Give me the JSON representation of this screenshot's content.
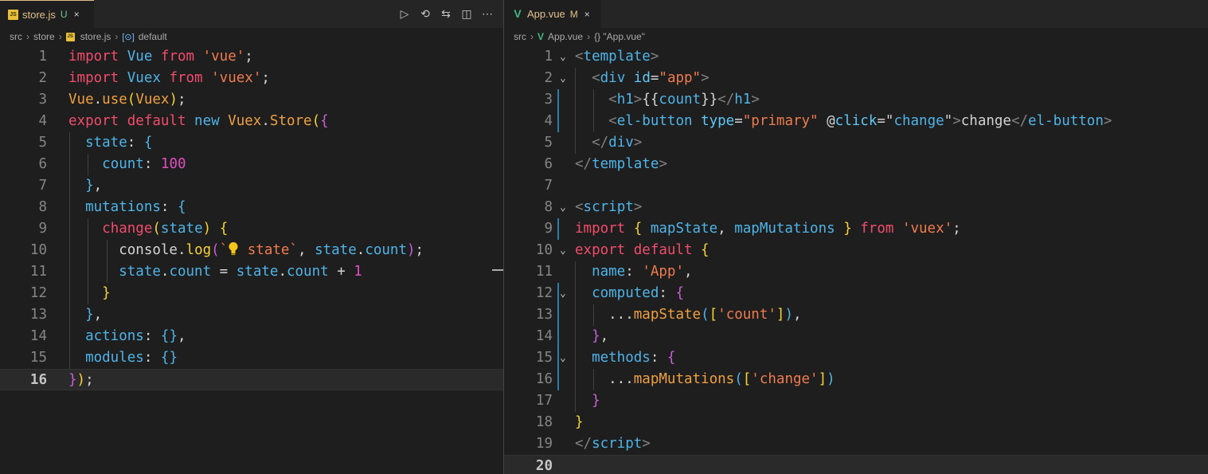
{
  "left": {
    "tab": {
      "icon": "JS",
      "name": "store.js",
      "badge": "U",
      "close": "×"
    },
    "actions": [
      "run-icon",
      "history-icon",
      "compare-icon",
      "split-icon",
      "more-icon"
    ],
    "breadcrumb": [
      "src",
      "store",
      "store.js",
      "default"
    ],
    "lines": [
      {
        "n": "1",
        "segs": [
          [
            "k",
            "import "
          ],
          [
            "v",
            "Vue "
          ],
          [
            "k",
            "from "
          ],
          [
            "s",
            "'vue'"
          ],
          [
            "p",
            ";"
          ]
        ]
      },
      {
        "n": "2",
        "segs": [
          [
            "k",
            "import "
          ],
          [
            "v",
            "Vuex "
          ],
          [
            "k",
            "from "
          ],
          [
            "s",
            "'vuex'"
          ],
          [
            "p",
            ";"
          ]
        ]
      },
      {
        "n": "3",
        "segs": [
          [
            "f",
            "Vue"
          ],
          [
            "p",
            "."
          ],
          [
            "f",
            "use"
          ],
          [
            "y",
            "("
          ],
          [
            "f",
            "Vuex"
          ],
          [
            "y",
            ")"
          ],
          [
            "p",
            ";"
          ]
        ]
      },
      {
        "n": "4",
        "segs": [
          [
            "k",
            "export default "
          ],
          [
            "v",
            "new "
          ],
          [
            "f",
            "Vuex"
          ],
          [
            "p",
            "."
          ],
          [
            "f",
            "Store"
          ],
          [
            "y",
            "("
          ],
          [
            "m",
            "{"
          ]
        ]
      },
      {
        "n": "5",
        "segs": [
          [
            "p",
            "  "
          ],
          [
            "v",
            "state"
          ],
          [
            "p",
            ": "
          ],
          [
            "v",
            "{"
          ]
        ]
      },
      {
        "n": "6",
        "segs": [
          [
            "p",
            "    "
          ],
          [
            "v",
            "count"
          ],
          [
            "p",
            ": "
          ],
          [
            "n",
            "100"
          ]
        ]
      },
      {
        "n": "7",
        "segs": [
          [
            "p",
            "  "
          ],
          [
            "v",
            "}"
          ],
          [
            "p",
            ","
          ]
        ]
      },
      {
        "n": "8",
        "segs": [
          [
            "p",
            "  "
          ],
          [
            "v",
            "mutations"
          ],
          [
            "p",
            ": "
          ],
          [
            "v",
            "{"
          ]
        ]
      },
      {
        "n": "9",
        "segs": [
          [
            "p",
            "    "
          ],
          [
            "k",
            "change"
          ],
          [
            "y",
            "("
          ],
          [
            "v",
            "state"
          ],
          [
            "y",
            ")"
          ],
          [
            "p",
            " "
          ],
          [
            "y",
            "{"
          ]
        ]
      },
      {
        "n": "10",
        "segs": [
          [
            "p",
            "      "
          ],
          [
            "w",
            "console"
          ],
          [
            "p",
            "."
          ],
          [
            "y",
            "log"
          ],
          [
            "m",
            "("
          ],
          [
            "s",
            "`"
          ],
          [
            "lamp",
            ""
          ],
          [
            "s",
            " state`"
          ],
          [
            "p",
            ", "
          ],
          [
            "v",
            "state"
          ],
          [
            "p",
            "."
          ],
          [
            "v",
            "count"
          ],
          [
            "m",
            ")"
          ],
          [
            "p",
            ";"
          ]
        ]
      },
      {
        "n": "11",
        "segs": [
          [
            "p",
            "      "
          ],
          [
            "v",
            "state"
          ],
          [
            "p",
            "."
          ],
          [
            "v",
            "count"
          ],
          [
            "p",
            " = "
          ],
          [
            "v",
            "state"
          ],
          [
            "p",
            "."
          ],
          [
            "v",
            "count"
          ],
          [
            "p",
            " + "
          ],
          [
            "n",
            "1"
          ]
        ]
      },
      {
        "n": "12",
        "segs": [
          [
            "p",
            "    "
          ],
          [
            "y",
            "}"
          ]
        ]
      },
      {
        "n": "13",
        "segs": [
          [
            "p",
            "  "
          ],
          [
            "v",
            "}"
          ],
          [
            "p",
            ","
          ]
        ]
      },
      {
        "n": "14",
        "segs": [
          [
            "p",
            "  "
          ],
          [
            "v",
            "actions"
          ],
          [
            "p",
            ": "
          ],
          [
            "v",
            "{}"
          ],
          [
            "p",
            ","
          ]
        ]
      },
      {
        "n": "15",
        "segs": [
          [
            "p",
            "  "
          ],
          [
            "v",
            "modules"
          ],
          [
            "p",
            ": "
          ],
          [
            "v",
            "{}"
          ]
        ]
      },
      {
        "n": "16",
        "segs": [
          [
            "m",
            "}"
          ],
          [
            "y",
            ")"
          ],
          [
            "p",
            ";"
          ]
        ],
        "current": true
      }
    ]
  },
  "right": {
    "tab": {
      "icon": "V",
      "name": "App.vue",
      "badge": "M",
      "close": "×"
    },
    "breadcrumb": [
      "src",
      "App.vue",
      "{} \"App.vue\""
    ],
    "lines": [
      {
        "n": "1",
        "fold": true,
        "segs": [
          [
            "t",
            "<"
          ],
          [
            "tg",
            "template"
          ],
          [
            "t",
            ">"
          ]
        ]
      },
      {
        "n": "2",
        "fold": true,
        "segs": [
          [
            "p",
            "  "
          ],
          [
            "t",
            "<"
          ],
          [
            "tg",
            "div "
          ],
          [
            "at",
            "id"
          ],
          [
            "p",
            "="
          ],
          [
            "s",
            "\"app\""
          ],
          [
            "t",
            ">"
          ]
        ]
      },
      {
        "n": "3",
        "segs": [
          [
            "p",
            "    "
          ],
          [
            "t",
            "<"
          ],
          [
            "tg",
            "h1"
          ],
          [
            "t",
            ">"
          ],
          [
            "p",
            "{{"
          ],
          [
            "v",
            "count"
          ],
          [
            "p",
            "}}"
          ],
          [
            "t",
            "</"
          ],
          [
            "tg",
            "h1"
          ],
          [
            "t",
            ">"
          ]
        ]
      },
      {
        "n": "4",
        "segs": [
          [
            "p",
            "    "
          ],
          [
            "t",
            "<"
          ],
          [
            "tg",
            "el-button "
          ],
          [
            "at",
            "type"
          ],
          [
            "p",
            "="
          ],
          [
            "s",
            "\"primary\""
          ],
          [
            "p",
            " @"
          ],
          [
            "at",
            "click"
          ],
          [
            "p",
            "=\""
          ],
          [
            "v",
            "change"
          ],
          [
            "p",
            "\""
          ],
          [
            "t",
            ">"
          ],
          [
            "p",
            "change"
          ],
          [
            "t",
            "</"
          ],
          [
            "tg",
            "el-button"
          ],
          [
            "t",
            ">"
          ]
        ]
      },
      {
        "n": "5",
        "segs": [
          [
            "p",
            "  "
          ],
          [
            "t",
            "</"
          ],
          [
            "tg",
            "div"
          ],
          [
            "t",
            ">"
          ]
        ]
      },
      {
        "n": "6",
        "segs": [
          [
            "t",
            "</"
          ],
          [
            "tg",
            "template"
          ],
          [
            "t",
            ">"
          ]
        ]
      },
      {
        "n": "7",
        "segs": []
      },
      {
        "n": "8",
        "fold": true,
        "segs": [
          [
            "t",
            "<"
          ],
          [
            "tg",
            "script"
          ],
          [
            "t",
            ">"
          ]
        ]
      },
      {
        "n": "9",
        "segs": [
          [
            "k",
            "import "
          ],
          [
            "y",
            "{ "
          ],
          [
            "v",
            "mapState"
          ],
          [
            "p",
            ", "
          ],
          [
            "v",
            "mapMutations"
          ],
          [
            "y",
            " } "
          ],
          [
            "k",
            "from "
          ],
          [
            "s",
            "'vuex'"
          ],
          [
            "p",
            ";"
          ]
        ]
      },
      {
        "n": "10",
        "fold": true,
        "segs": [
          [
            "k",
            "export default "
          ],
          [
            "y",
            "{"
          ]
        ]
      },
      {
        "n": "11",
        "segs": [
          [
            "p",
            "  "
          ],
          [
            "v",
            "name"
          ],
          [
            "p",
            ": "
          ],
          [
            "s",
            "'App'"
          ],
          [
            "p",
            ","
          ]
        ]
      },
      {
        "n": "12",
        "fold": true,
        "segs": [
          [
            "p",
            "  "
          ],
          [
            "v",
            "computed"
          ],
          [
            "p",
            ": "
          ],
          [
            "m",
            "{"
          ]
        ]
      },
      {
        "n": "13",
        "segs": [
          [
            "p",
            "    ..."
          ],
          [
            "f",
            "mapState"
          ],
          [
            "v",
            "("
          ],
          [
            "y",
            "["
          ],
          [
            "s",
            "'count'"
          ],
          [
            "y",
            "]"
          ],
          [
            "v",
            ")"
          ],
          [
            "p",
            ","
          ]
        ]
      },
      {
        "n": "14",
        "segs": [
          [
            "p",
            "  "
          ],
          [
            "m",
            "}"
          ],
          [
            "p",
            ","
          ]
        ]
      },
      {
        "n": "15",
        "fold": true,
        "segs": [
          [
            "p",
            "  "
          ],
          [
            "v",
            "methods"
          ],
          [
            "p",
            ": "
          ],
          [
            "m",
            "{"
          ]
        ]
      },
      {
        "n": "16",
        "segs": [
          [
            "p",
            "    ..."
          ],
          [
            "f",
            "mapMutations"
          ],
          [
            "v",
            "("
          ],
          [
            "y",
            "["
          ],
          [
            "s",
            "'change'"
          ],
          [
            "y",
            "]"
          ],
          [
            "v",
            ")"
          ]
        ]
      },
      {
        "n": "17",
        "segs": [
          [
            "p",
            "  "
          ],
          [
            "m",
            "}"
          ]
        ]
      },
      {
        "n": "18",
        "segs": [
          [
            "y",
            "}"
          ]
        ]
      },
      {
        "n": "19",
        "segs": [
          [
            "t",
            "</"
          ],
          [
            "tg",
            "script"
          ],
          [
            "t",
            ">"
          ]
        ]
      },
      {
        "n": "20",
        "segs": [],
        "current": true
      }
    ]
  }
}
